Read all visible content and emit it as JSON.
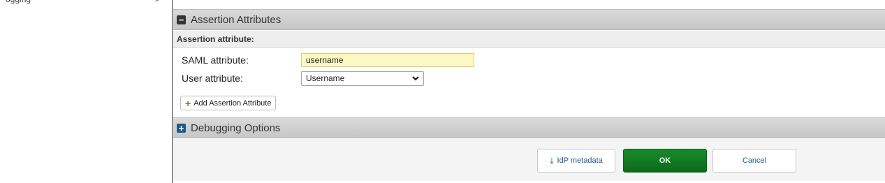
{
  "nav": {
    "cut_text": "ogging",
    "cut_chevron": ">"
  },
  "top_cut": ")",
  "assertion_section": {
    "title": "Assertion Attributes",
    "subheader": "Assertion attribute:",
    "saml_label": "SAML attribute:",
    "saml_value": "username",
    "user_label": "User attribute:",
    "user_selected": "Username",
    "add_button": "Add Assertion Attribute"
  },
  "debug_section": {
    "title": "Debugging Options"
  },
  "footer": {
    "metadata_button": "IdP metadata",
    "ok_button": "OK",
    "cancel_button": "Cancel"
  },
  "colors": {
    "ok_green": "#0b6b1c",
    "input_highlight": "#fcf8c4",
    "plus_blue": "#1d5a8a"
  }
}
